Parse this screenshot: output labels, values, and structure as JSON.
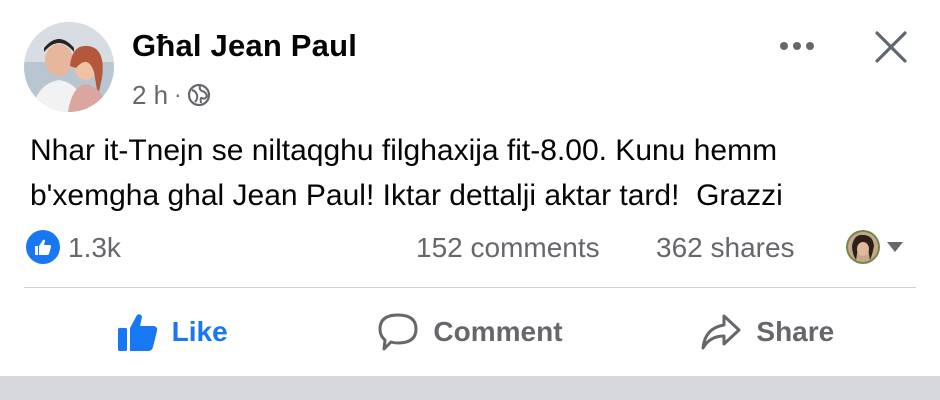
{
  "post": {
    "author_name": "Għal Jean Paul",
    "time_ago": "2 h",
    "separator": "·",
    "privacy_icon": "globe-icon",
    "text": "Nhar it-Tnejn se niltaqghu filghaxija fit-8.00. Kunu hemm\nb'xemgha ghal Jean Paul! Iktar dettalji aktar tard!  Grazzi"
  },
  "stats": {
    "reactions": "1.3k",
    "comments": "152 comments",
    "shares": "362 shares"
  },
  "actions": {
    "like_label": "Like",
    "comment_label": "Comment",
    "share_label": "Share"
  },
  "colors": {
    "accent": "#1877f2",
    "secondary_text": "#65676b",
    "primary_text": "#050505",
    "divider": "#ced0d4"
  }
}
